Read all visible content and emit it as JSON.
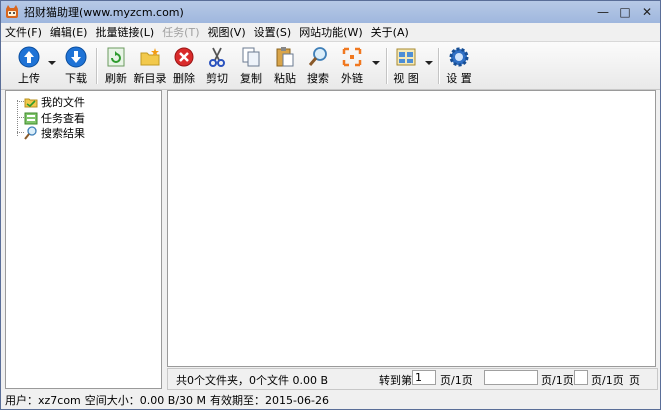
{
  "window": {
    "title": "招财猫助理(www.myzcm.com)"
  },
  "menu": [
    {
      "label": "文件(F)",
      "disabled": false
    },
    {
      "label": "编辑(E)",
      "disabled": false
    },
    {
      "label": "批量链接(L)",
      "disabled": false
    },
    {
      "label": "任务(T)",
      "disabled": true
    },
    {
      "label": "视图(V)",
      "disabled": false
    },
    {
      "label": "设置(S)",
      "disabled": false
    },
    {
      "label": "网站功能(W)",
      "disabled": false
    },
    {
      "label": "关于(A)",
      "disabled": false
    }
  ],
  "toolbar": {
    "upload": "上传",
    "download": "下载",
    "refresh": "刷新",
    "new_folder": "新目录",
    "delete": "删除",
    "cut": "剪切",
    "copy": "复制",
    "paste": "粘贴",
    "search": "搜索",
    "external_link": "外链",
    "view": "视 图",
    "settings": "设 置"
  },
  "tree": {
    "items": [
      {
        "label": "我的文件",
        "icon": "folder-icon"
      },
      {
        "label": "任务查看",
        "icon": "task-icon"
      },
      {
        "label": "搜索结果",
        "icon": "search-icon"
      }
    ]
  },
  "pager": {
    "summary": "共0个文件夹，0个文件 0.00 B",
    "goto_label": "转到第",
    "page_value": "1",
    "page_unit_1": "页/1页",
    "page_unit_2": "页/1页",
    "page_unit_3": "页/1页",
    "page_unit_4": "页"
  },
  "status": {
    "user": "用户：xz7com",
    "space": "空间大小：0.00 B/30 M",
    "expiry": "有效期至：2015-06-26"
  }
}
